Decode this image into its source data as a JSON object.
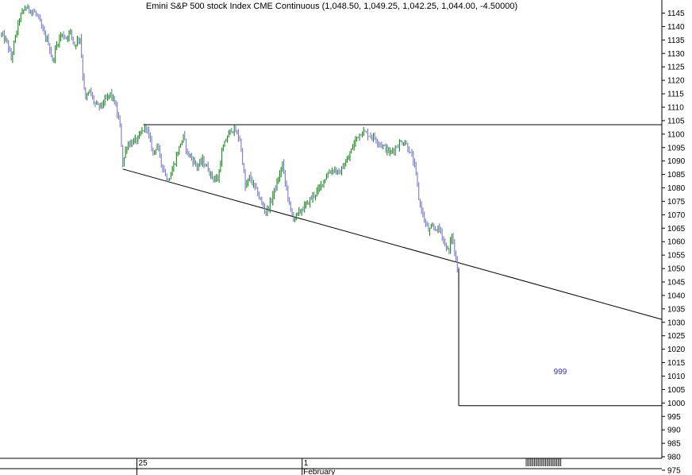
{
  "title": "Emini S&P 500 stock Index CME Continuous (1,048.50, 1,049.25, 1,042.25, 1,044.00, -4.50000)",
  "annotation": "999",
  "colors": {
    "up": "#1a8a1a",
    "down": "#7a7ac8",
    "lines": "#000000",
    "annotation": "#3333aa",
    "background": "#ffffff"
  },
  "chart_data": {
    "type": "candlestick",
    "y_axis": {
      "position": "right",
      "range": [
        972,
        1148
      ],
      "ticks": [
        975,
        980,
        985,
        990,
        995,
        1000,
        1005,
        1010,
        1015,
        1020,
        1025,
        1030,
        1035,
        1040,
        1045,
        1050,
        1055,
        1060,
        1065,
        1070,
        1075,
        1080,
        1085,
        1090,
        1095,
        1100,
        1105,
        1110,
        1115,
        1120,
        1125,
        1130,
        1135,
        1140,
        1145
      ]
    },
    "x_axis": {
      "units": "bar index",
      "range": [
        0,
        480
      ],
      "labels": [
        {
          "text": "25",
          "bar": 98
        },
        {
          "text": "1",
          "bar": 218
        }
      ],
      "sublabels": [
        {
          "text": "February",
          "bar": 218
        }
      ]
    },
    "trendlines": [
      {
        "name": "upper",
        "points": [
          [
            103,
            1103.5
          ],
          [
            480,
            1103.5
          ]
        ]
      },
      {
        "name": "lower",
        "points": [
          [
            88,
            1087
          ],
          [
            480,
            1031
          ]
        ]
      }
    ],
    "measured_move": {
      "from": [
        332,
        1050
      ],
      "to": [
        332,
        999
      ],
      "extend_to_bar": 480,
      "target": 999
    },
    "price_path": [
      [
        0,
        1137
      ],
      [
        4,
        1134
      ],
      [
        7,
        1128
      ],
      [
        10,
        1136
      ],
      [
        13,
        1143
      ],
      [
        17,
        1147
      ],
      [
        22,
        1146
      ],
      [
        26,
        1144
      ],
      [
        30,
        1138
      ],
      [
        34,
        1134
      ],
      [
        37,
        1127
      ],
      [
        40,
        1133
      ],
      [
        43,
        1137
      ],
      [
        47,
        1136
      ],
      [
        50,
        1138
      ],
      [
        53,
        1133
      ],
      [
        55,
        1135
      ],
      [
        57,
        1136
      ],
      [
        59,
        1122
      ],
      [
        61,
        1113
      ],
      [
        64,
        1116
      ],
      [
        67,
        1112
      ],
      [
        70,
        1110
      ],
      [
        73,
        1111
      ],
      [
        76,
        1113
      ],
      [
        79,
        1115
      ],
      [
        82,
        1112
      ],
      [
        86,
        1103
      ],
      [
        88,
        1089
      ],
      [
        91,
        1096
      ],
      [
        95,
        1097
      ],
      [
        99,
        1098
      ],
      [
        102,
        1101
      ],
      [
        105,
        1103
      ],
      [
        108,
        1097
      ],
      [
        110,
        1093
      ],
      [
        113,
        1096
      ],
      [
        116,
        1089
      ],
      [
        118,
        1087
      ],
      [
        120,
        1083
      ],
      [
        123,
        1085
      ],
      [
        126,
        1090
      ],
      [
        129,
        1095
      ],
      [
        132,
        1099
      ],
      [
        135,
        1093
      ],
      [
        138,
        1091
      ],
      [
        142,
        1088
      ],
      [
        146,
        1090
      ],
      [
        150,
        1087
      ],
      [
        153,
        1084
      ],
      [
        157,
        1083
      ],
      [
        160,
        1093
      ],
      [
        163,
        1098
      ],
      [
        167,
        1102
      ],
      [
        170,
        1101
      ],
      [
        173,
        1098
      ],
      [
        175,
        1090
      ],
      [
        177,
        1080
      ],
      [
        180,
        1084
      ],
      [
        183,
        1081
      ],
      [
        186,
        1078
      ],
      [
        189,
        1074
      ],
      [
        192,
        1071
      ],
      [
        195,
        1074
      ],
      [
        198,
        1079
      ],
      [
        201,
        1083
      ],
      [
        204,
        1089
      ],
      [
        206,
        1082
      ],
      [
        208,
        1077
      ],
      [
        210,
        1071
      ],
      [
        212,
        1069
      ],
      [
        215,
        1070
      ],
      [
        218,
        1072
      ],
      [
        222,
        1074
      ],
      [
        226,
        1077
      ],
      [
        230,
        1079
      ],
      [
        234,
        1083
      ],
      [
        238,
        1086
      ],
      [
        242,
        1087
      ],
      [
        245,
        1085
      ],
      [
        248,
        1088
      ],
      [
        251,
        1090
      ],
      [
        254,
        1094
      ],
      [
        258,
        1099
      ],
      [
        262,
        1101
      ],
      [
        266,
        1100
      ],
      [
        270,
        1099
      ],
      [
        274,
        1097
      ],
      [
        278,
        1095
      ],
      [
        282,
        1093
      ],
      [
        286,
        1095
      ],
      [
        290,
        1097
      ],
      [
        293,
        1097
      ],
      [
        296,
        1094
      ],
      [
        299,
        1090
      ],
      [
        301,
        1085
      ],
      [
        303,
        1076
      ],
      [
        305,
        1072
      ],
      [
        307,
        1068
      ],
      [
        310,
        1064
      ],
      [
        313,
        1065
      ],
      [
        316,
        1065
      ],
      [
        319,
        1064
      ],
      [
        322,
        1059
      ],
      [
        325,
        1056
      ],
      [
        327,
        1063
      ],
      [
        329,
        1056
      ],
      [
        331,
        1050
      ],
      [
        332,
        1044
      ]
    ]
  }
}
